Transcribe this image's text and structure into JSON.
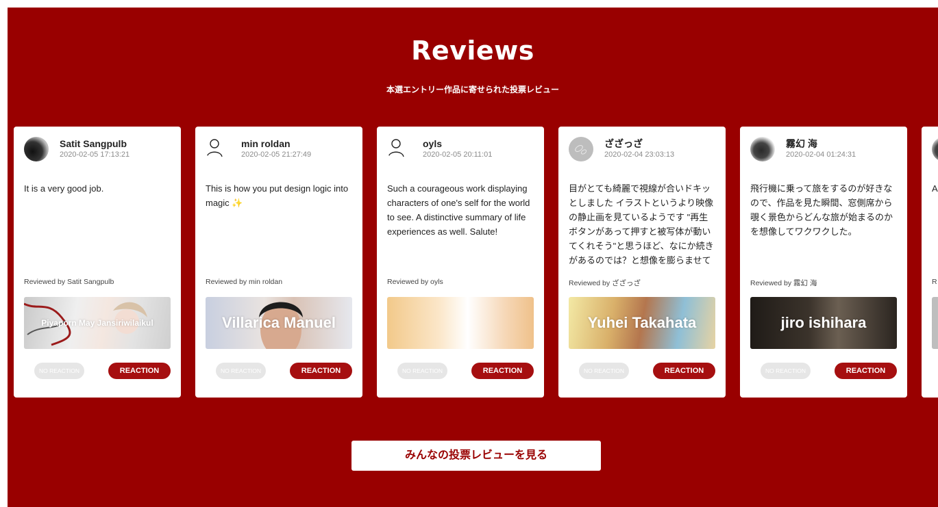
{
  "section": {
    "title": "Reviews",
    "subtitle": "本選エントリー作品に寄せられた投票レビュー"
  },
  "cards": [
    {
      "name": "Satit Sangpulb",
      "date": "2020-02-05 17:13:21",
      "review": "It is a very good job.",
      "reviewed_by": "Reviewed by Satit Sangpulb",
      "thumb_title": "Piyaporn May Jansiriwilaikul",
      "no_reaction": "NO REACTION",
      "reaction": "REACTION"
    },
    {
      "name": "min roldan",
      "date": "2020-02-05 21:27:49",
      "review": "This is how you put design logic into magic",
      "sparkle": "✨",
      "reviewed_by": "Reviewed by min roldan",
      "thumb_title": "Villarica Manuel",
      "no_reaction": "NO REACTION",
      "reaction": "REACTION"
    },
    {
      "name": "oyls",
      "date": "2020-02-05 20:11:01",
      "review": "Such a courageous work displaying characters of one's self for the world to see. A distinctive summary of life experiences as well. Salute!",
      "reviewed_by": "Reviewed by oyls",
      "thumb_title": "",
      "no_reaction": "NO REACTION",
      "reaction": "REACTION"
    },
    {
      "name": "ざざっざ",
      "date": "2020-02-04 23:03:13",
      "review": "目がとても綺麗で視線が合いドキッとしました イラストというより映像の静止画を見ているようです \"再生ボタンがあって押すと被写体が動いてくれそう\"と思うほど、なにか続きがあるのでは？と想像を膨らませてくれます",
      "reviewed_by": "Reviewed by ざざっざ",
      "thumb_title": "Yuhei Takahata",
      "no_reaction": "NO REACTION",
      "reaction": "REACTION"
    },
    {
      "name": "霧幻 海",
      "date": "2020-02-04 01:24:31",
      "review": "飛行機に乗って旅をするのが好きなので、作品を見た瞬間、窓側席から覗く景色からどんな旅が始まるのかを想像してワクワクした。",
      "reviewed_by": "Reviewed by 霧幻 海",
      "thumb_title": "jiro ishihara",
      "no_reaction": "NO REACTION",
      "reaction": "REACTION"
    },
    {
      "review": "A",
      "reviewed_by": "R"
    }
  ],
  "cta_label": "みんなの投票レビューを見る",
  "colors": {
    "background": "#990000",
    "card": "#ffffff",
    "reaction_button": "#a60f10",
    "no_reaction_button": "#e6e6e6"
  },
  "icons": [
    "user-outline-icon"
  ]
}
